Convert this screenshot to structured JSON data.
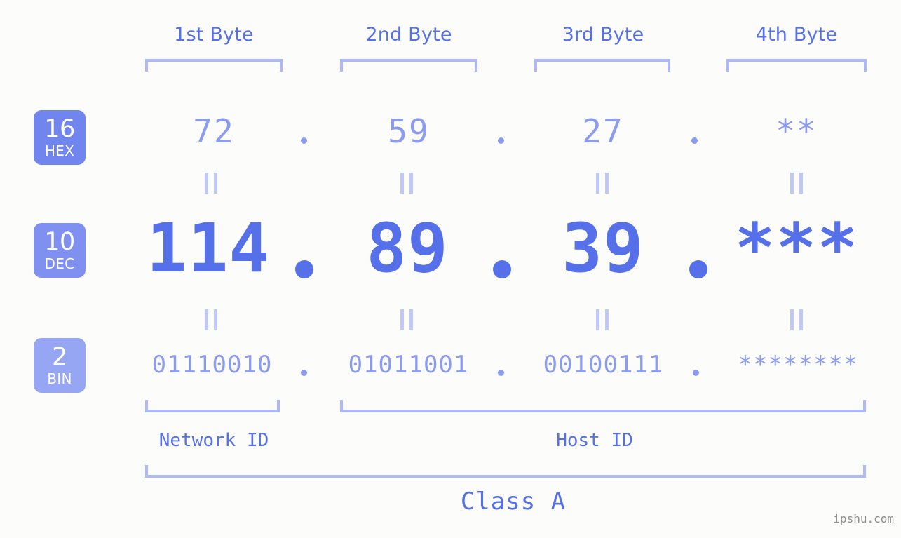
{
  "watermark": "ipshu.com",
  "byte_headers": [
    {
      "label": "1st Byte"
    },
    {
      "label": "2nd Byte"
    },
    {
      "label": "3rd Byte"
    },
    {
      "label": "4th Byte"
    }
  ],
  "bases": [
    {
      "num": "16",
      "abbr": "HEX",
      "color": "#7185ee"
    },
    {
      "num": "10",
      "abbr": "DEC",
      "color": "#8090f0"
    },
    {
      "num": "2",
      "abbr": "BIN",
      "color": "#97a6f3"
    }
  ],
  "rows": {
    "hex": {
      "base_num": "16",
      "base_abbr": "HEX",
      "values": [
        "72",
        "59",
        "27",
        "**"
      ],
      "separator": "."
    },
    "dec": {
      "base_num": "10",
      "base_abbr": "DEC",
      "values": [
        "114",
        "89",
        "39",
        "***"
      ],
      "separator": "."
    },
    "bin": {
      "base_num": "2",
      "base_abbr": "BIN",
      "values": [
        "01110010",
        "01011001",
        "00100111",
        "********"
      ],
      "separator": "."
    }
  },
  "equals_symbol": "||",
  "footer": {
    "network_id": "Network ID",
    "host_id": "Host ID",
    "class": "Class A"
  },
  "colors": {
    "accent_strong": "#5570e8",
    "accent_light": "#8b9bf0",
    "bracket": "#aeb8f7",
    "background": "#fcfdfa",
    "watermark": "#8d8d8d"
  }
}
